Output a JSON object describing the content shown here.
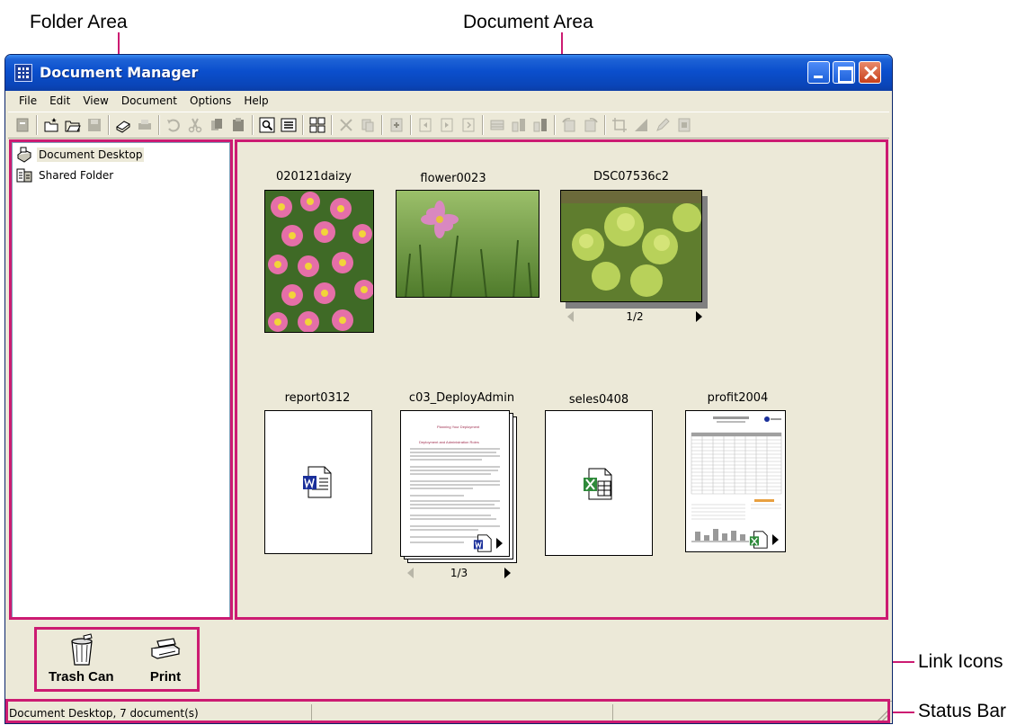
{
  "callouts": {
    "folder_area": "Folder Area",
    "document_area": "Document Area",
    "link_icons": "Link Icons",
    "status_bar": "Status Bar"
  },
  "window": {
    "title": "Document Manager",
    "accent": "#cc1b72"
  },
  "menu": [
    "File",
    "Edit",
    "View",
    "Document",
    "Options",
    "Help"
  ],
  "folders": [
    {
      "label": "Document Desktop",
      "icon": "document-desktop-icon",
      "selected": true
    },
    {
      "label": "Shared Folder",
      "icon": "shared-folder-icon",
      "selected": false
    }
  ],
  "documents": [
    {
      "name": "020121daizy",
      "kind": "photo",
      "subject": "pink daisies"
    },
    {
      "name": "flower0023",
      "kind": "photo",
      "subject": "cosmos flower in grass"
    },
    {
      "name": "DSC07536c2",
      "kind": "photo",
      "subject": "green plants",
      "page": "1/2"
    },
    {
      "name": "report0312",
      "kind": "word"
    },
    {
      "name": "c03_DeployAdmin",
      "kind": "word-preview",
      "page": "1/3",
      "heading": "Planning Your Deployment",
      "subheading": "Deployment and Administration Roles"
    },
    {
      "name": "seles0408",
      "kind": "excel"
    },
    {
      "name": "profit2004",
      "kind": "excel-preview"
    }
  ],
  "links": [
    {
      "label": "Trash Can",
      "icon": "trash-can-icon"
    },
    {
      "label": "Print",
      "icon": "printer-icon"
    }
  ],
  "status": {
    "text": "Document Desktop, 7 document(s)"
  }
}
